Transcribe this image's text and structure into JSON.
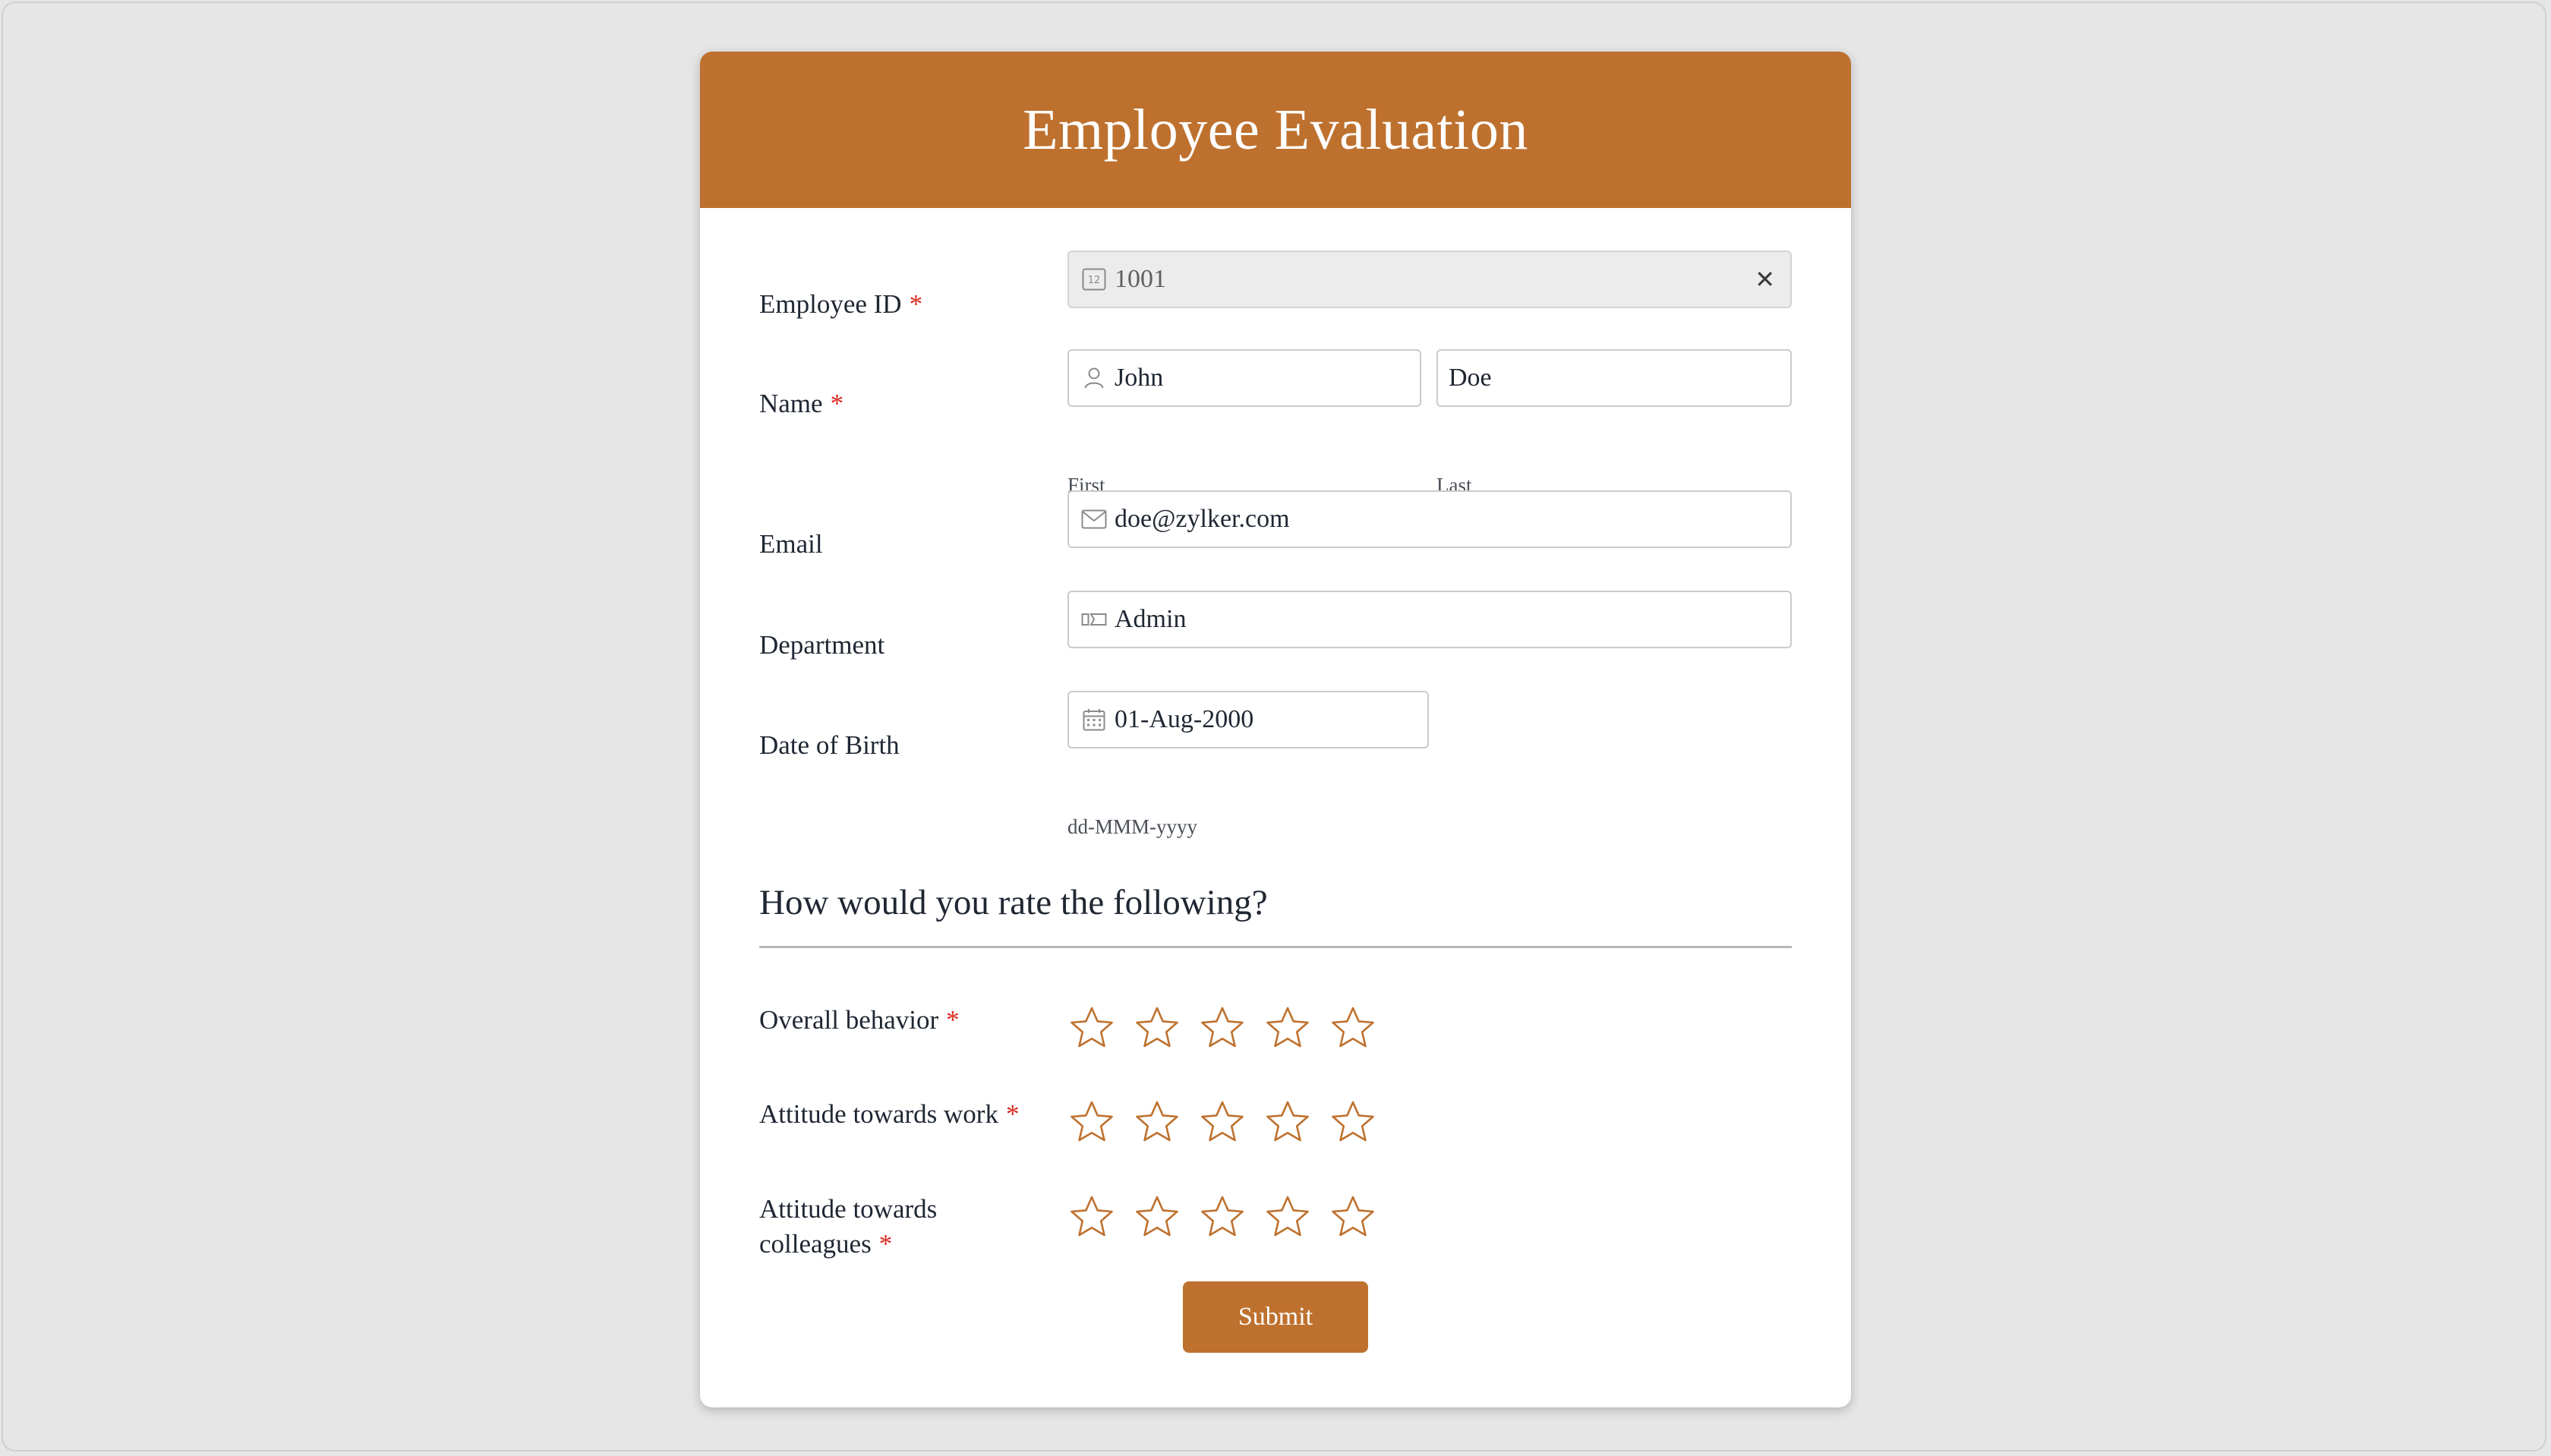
{
  "form": {
    "title": "Employee Evaluation",
    "required_mark": "*",
    "employee_id": {
      "label": "Employee ID",
      "value": "1001",
      "icon": "number-icon",
      "clear_icon": "close-icon",
      "clear_glyph": "✕",
      "required": true,
      "disabled": true
    },
    "name": {
      "label": "Name",
      "required": true,
      "first": {
        "value": "John",
        "sublabel": "First",
        "icon": "user-icon"
      },
      "last": {
        "value": "Doe",
        "sublabel": "Last"
      }
    },
    "email": {
      "label": "Email",
      "value": "doe@zylker.com",
      "icon": "envelope-icon"
    },
    "department": {
      "label": "Department",
      "value": "Admin",
      "icon": "dropdown-icon"
    },
    "dob": {
      "label": "Date of Birth",
      "value": "01-Aug-2000",
      "format_hint": "dd-MMM-yyyy",
      "icon": "calendar-icon"
    },
    "rating_section": {
      "title": "How would you rate the following?",
      "max_stars": 5,
      "items": [
        {
          "label": "Overall behavior",
          "rating": 0,
          "required": true
        },
        {
          "label": "Attitude towards work",
          "rating": 0,
          "required": true
        },
        {
          "label": "Attitude towards",
          "label_line2": "colleagues",
          "rating": 0,
          "required": true
        }
      ]
    },
    "submit_label": "Submit"
  },
  "colors": {
    "accent": "#be712e",
    "required": "#d9261c",
    "background": "#e6e6e6",
    "card": "#ffffff",
    "field_border": "#cbcbcb",
    "disabled_field": "#ececec"
  }
}
